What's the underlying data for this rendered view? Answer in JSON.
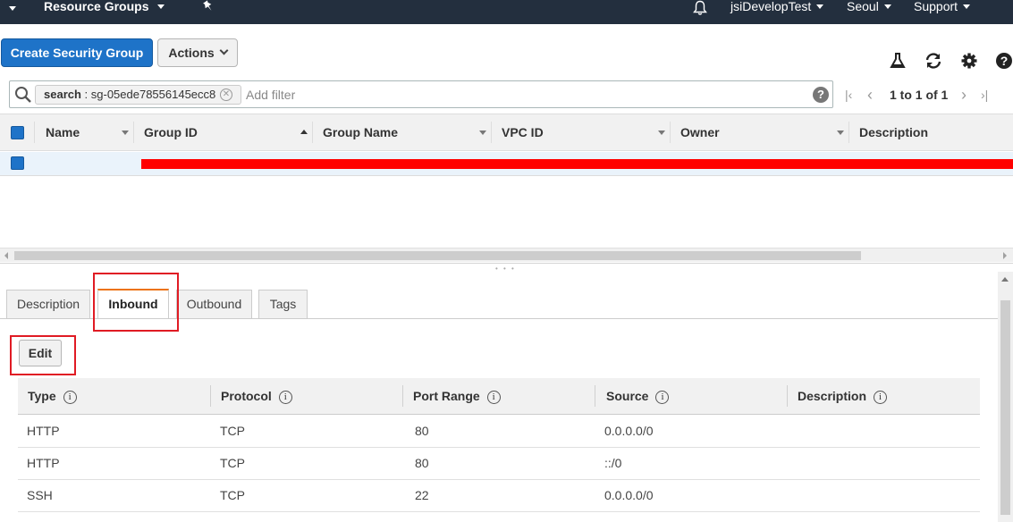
{
  "topbar": {
    "resource_groups": "Resource Groups",
    "account": "jsiDevelopTest",
    "region": "Seoul",
    "support": "Support"
  },
  "toolbar": {
    "create_label": "Create Security Group",
    "actions_label": "Actions",
    "icons": [
      "flask-icon",
      "refresh-icon",
      "gear-icon",
      "help-icon"
    ]
  },
  "filter": {
    "chip_key": "search",
    "chip_value": " : sg-05ede78556145ecc8",
    "placeholder": "Add filter",
    "pagination": "1 to 1 of 1"
  },
  "grid": {
    "columns": [
      "Name",
      "Group ID",
      "Group Name",
      "VPC ID",
      "Owner",
      "Description"
    ],
    "selected_row_redacted": true
  },
  "detail": {
    "tabs": [
      "Description",
      "Inbound",
      "Outbound",
      "Tags"
    ],
    "active_tab": "Inbound",
    "edit_label": "Edit",
    "rules_columns": [
      "Type",
      "Protocol",
      "Port Range",
      "Source",
      "Description"
    ],
    "rules": [
      {
        "type": "HTTP",
        "protocol": "TCP",
        "port": "80",
        "source": "0.0.0.0/0",
        "description": ""
      },
      {
        "type": "HTTP",
        "protocol": "TCP",
        "port": "80",
        "source": "::/0",
        "description": ""
      },
      {
        "type": "SSH",
        "protocol": "TCP",
        "port": "22",
        "source": "0.0.0.0/0",
        "description": ""
      }
    ]
  },
  "colors": {
    "nav_bg": "#232f3e",
    "primary": "#1e73c8",
    "tab_accent": "#ec7211",
    "highlight_box": "#e01b24",
    "redaction": "#ff0000"
  }
}
